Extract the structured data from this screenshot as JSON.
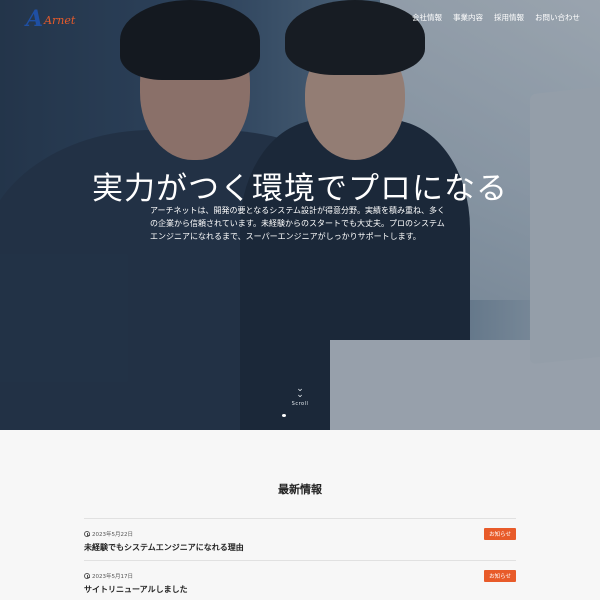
{
  "header": {
    "logo_mark": "A",
    "logo_word": "Arnet",
    "nav": [
      "会社情報",
      "事業内容",
      "採用情報",
      "お問い合わせ"
    ]
  },
  "hero": {
    "title": "実力がつく環境でプロになる",
    "description": "アーチネットは、開発の要となるシステム設計が得意分野。実績を積み重ね、多くの企業から信頼されています。未経験からのスタートでも大丈夫。プロのシステムエンジニアになれるまで、スーパーエンジニアがしっかりサポートします。",
    "scroll_label": "Scroll"
  },
  "news": {
    "title": "最新情報",
    "items": [
      {
        "date": "2023年5月22日",
        "headline": "未経験でもシステムエンジニアになれる理由",
        "badge": "お知らせ"
      },
      {
        "date": "2023年5月17日",
        "headline": "サイトリニューアルしました",
        "badge": "お知らせ"
      }
    ]
  },
  "colors": {
    "accent": "#e85b2a",
    "logo_blue": "#1f4fa3"
  },
  "icons": {
    "scroll": "chevron-down-icon",
    "date": "clock-icon"
  }
}
